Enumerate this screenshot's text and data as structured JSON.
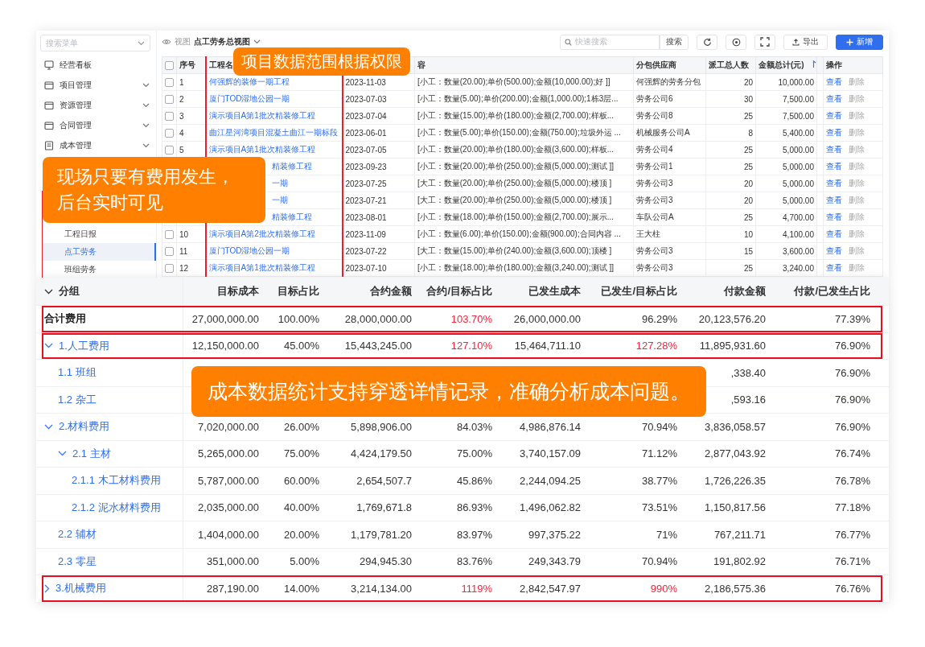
{
  "sidebar": {
    "search": {
      "placeholder": "搜索菜单"
    },
    "items": [
      {
        "label": "经营看板",
        "expandable": false
      },
      {
        "label": "项目管理",
        "expandable": true
      },
      {
        "label": "资源管理",
        "expandable": true
      },
      {
        "label": "合同管理",
        "expandable": true
      },
      {
        "label": "成本管理",
        "expandable": true
      }
    ],
    "submenu": {
      "highlighted": true,
      "items": [
        {
          "label": "工程日报",
          "selected": false
        },
        {
          "label": "点工劳务",
          "selected": true
        },
        {
          "label": "班组劳务",
          "selected": false
        }
      ]
    }
  },
  "toolbar": {
    "view_label": "视图",
    "view_name": "点工劳务总视图",
    "search": {
      "placeholder": "快速搜索"
    },
    "buttons": [
      {
        "kind": "search",
        "label": "搜索"
      },
      {
        "kind": "refresh"
      },
      {
        "kind": "settings"
      },
      {
        "kind": "fullscreen"
      },
      {
        "kind": "export",
        "label": "导出"
      },
      {
        "kind": "add",
        "label": "新增"
      }
    ]
  },
  "work_table": {
    "select_all_checked": false,
    "name_column_highlighted": true,
    "headers": {
      "seq": "序号",
      "name": "工程名",
      "content": "容",
      "supplier": "分包供应商",
      "workers": "派工总人数",
      "amount": "金额总计(元)",
      "actions": "操作"
    },
    "rows": [
      {
        "covered": false,
        "checked": false,
        "seq": "1",
        "name": "何强辉的装修一期工程",
        "date": "2023-11-03",
        "content": "[小工：数量(20.00);单价(500.00);金额(10,000.00);好 ]]",
        "supplier": "何强辉的劳务分包",
        "workers": "20",
        "amount": "10,000.00",
        "view": "查看",
        "delete": "删除"
      },
      {
        "covered": false,
        "checked": false,
        "seq": "2",
        "name": "厦门TOD湿地公园一期",
        "date": "2023-07-03",
        "content": "[小工：数量(5.00);单价(200.00);金额(1,000.00);1栋3层...",
        "supplier": "劳务公司6",
        "workers": "30",
        "amount": "7,500.00",
        "view": "查看",
        "delete": "删除"
      },
      {
        "covered": false,
        "checked": false,
        "seq": "3",
        "name": "演示项目A第1批次精装修工程",
        "date": "2023-07-04",
        "content": "[小工：数量(15.00);单价(180.00);金额(2,700.00);样板...",
        "supplier": "劳务公司8",
        "workers": "25",
        "amount": "7,500.00",
        "view": "查看",
        "delete": "删除"
      },
      {
        "covered": false,
        "checked": false,
        "seq": "4",
        "name": "曲江星河湾项目混凝土曲江一期标段",
        "date": "2023-06-01",
        "content": "[小工：数量(5.00);单价(150.00);金额(750.00);垃圾外运 ...",
        "supplier": "机械服务公司A",
        "workers": "8",
        "amount": "5,400.00",
        "view": "查看",
        "delete": "删除"
      },
      {
        "covered": false,
        "checked": false,
        "seq": "5",
        "name": "演示项目A第1批次精装修工程",
        "date": "2023-07-05",
        "content": "[小工：数量(20.00);单价(180.00);金额(3,600.00);样板...",
        "supplier": "劳务公司4",
        "workers": "25",
        "amount": "5,000.00",
        "view": "查看",
        "delete": "删除"
      },
      {
        "covered": true,
        "name": "精装修工程",
        "date": "2023-09-23",
        "content": "[小工：数量(20.00);单价(250.00);金额(5,000.00);测试 ]]",
        "supplier": "劳务公司1",
        "workers": "25",
        "amount": "5,000.00",
        "view": "查看",
        "delete": "删除"
      },
      {
        "covered": true,
        "name": "一期",
        "date": "2023-07-25",
        "content": "[大工：数量(20.00);单价(250.00);金额(5,000.00);楼顶 ]",
        "supplier": "劳务公司3",
        "workers": "20",
        "amount": "5,000.00",
        "view": "查看",
        "delete": "删除"
      },
      {
        "covered": true,
        "name": "一期",
        "date": "2023-07-21",
        "content": "[大工：数量(20.00);单价(250.00);金额(5,000.00);楼顶 ]",
        "supplier": "劳务公司3",
        "workers": "20",
        "amount": "5,000.00",
        "view": "查看",
        "delete": "删除"
      },
      {
        "covered": true,
        "name": "精装修工程",
        "date": "2023-08-01",
        "content": "[小工：数量(18.00);单价(150.00);金额(2,700.00);展示...",
        "supplier": "车队公司A",
        "workers": "25",
        "amount": "4,700.00",
        "view": "查看",
        "delete": "删除"
      },
      {
        "covered": false,
        "checked": false,
        "seq": "10",
        "name": "演示项目A第2批次精装修工程",
        "date": "2023-11-09",
        "content": "[小工：数量(6.00);单价(150.00);金额(900.00);合同内容 ...",
        "supplier": "王大柱",
        "workers": "10",
        "amount": "4,100.00",
        "view": "查看",
        "delete": "删除"
      },
      {
        "covered": false,
        "checked": false,
        "seq": "11",
        "name": "厦门TOD湿地公园一期",
        "date": "2023-07-22",
        "content": "[大工：数量(15.00);单价(240.00);金额(3,600.00);顶楼 ]",
        "supplier": "劳务公司3",
        "workers": "15",
        "amount": "3,600.00",
        "view": "查看",
        "delete": "删除"
      },
      {
        "covered": false,
        "checked": false,
        "seq": "12",
        "name": "演示项目A第1批次精装修工程",
        "date": "2023-07-10",
        "content": "[小工：数量(18.00);单价(180.00);金额(3,240.00);测试 ]]",
        "supplier": "劳务公司3",
        "workers": "25",
        "amount": "3,240.00",
        "view": "查看",
        "delete": "删除"
      }
    ]
  },
  "cost_table": {
    "group_column": "分组",
    "columns": [
      "目标成本",
      "目标占比",
      "合约金额",
      "合约/目标占比",
      "已发生成本",
      "已发生/目标占比",
      "付款金额",
      "付款/已发生占比"
    ],
    "rows": [
      {
        "kind": "total",
        "name": "合计费用",
        "highlighted": true,
        "contract_ratio_warning": true,
        "incurred_ratio_warning": false,
        "cells": [
          "27,000,000.00",
          "100.00%",
          "28,000,000.00",
          "103.70%",
          "26,000,000.00",
          "96.29%",
          "20,123,576.20",
          "77.39%"
        ]
      },
      {
        "kind": "group",
        "name": "1.人工费用",
        "expanded": true,
        "highlighted": true,
        "contract_ratio_warning": true,
        "incurred_ratio_warning": true,
        "cells": [
          "12,150,000.00",
          "45.00%",
          "15,443,245.00",
          "127.10%",
          "15,464,711.10",
          "127.28%",
          "11,895,931.60",
          "76.90%"
        ],
        "children": [
          {
            "kind": "item",
            "name": "1.1 班组",
            "highlighted": false,
            "cells": [
              null,
              null,
              null,
              null,
              null,
              null,
              ",338.40",
              "76.90%"
            ]
          },
          {
            "kind": "item",
            "name": "1.2 杂工",
            "highlighted": false,
            "cells": [
              null,
              null,
              null,
              null,
              null,
              null,
              ",593.16",
              "76.90%"
            ]
          }
        ]
      },
      {
        "kind": "group",
        "name": "2.材料费用",
        "expanded": true,
        "highlighted": false,
        "contract_ratio_warning": false,
        "incurred_ratio_warning": false,
        "cells": [
          "7,020,000.00",
          "26.00%",
          "5,898,906.00",
          "84.03%",
          "4,986,876.14",
          "70.94%",
          "3,836,058.57",
          "76.90%"
        ],
        "children": [
          {
            "kind": "group",
            "name": "2.1 主材",
            "expanded": true,
            "highlighted": false,
            "contract_ratio_warning": false,
            "incurred_ratio_warning": false,
            "cells": [
              "5,265,000.00",
              "75.00%",
              "4,424,179.50",
              "75.00%",
              "3,740,157.09",
              "71.12%",
              "2,877,043.92",
              "76.74%"
            ],
            "children": [
              {
                "kind": "item",
                "name": "2.1.1 木工材料费用",
                "highlighted": false,
                "contract_ratio_warning": false,
                "incurred_ratio_warning": false,
                "cells": [
                  "5,787,000.00",
                  "60.00%",
                  "2,654,507.7",
                  "45.86%",
                  "2,244,094.25",
                  "38.77%",
                  "1,726,226.35",
                  "76.78%"
                ]
              },
              {
                "kind": "item",
                "name": "2.1.2 泥水材料费用",
                "highlighted": false,
                "contract_ratio_warning": false,
                "incurred_ratio_warning": false,
                "cells": [
                  "2,035,000.00",
                  "40.00%",
                  "1,769,671.8",
                  "86.93%",
                  "1,496,062.82",
                  "73.51%",
                  "1,150,817.56",
                  "77.18%"
                ]
              }
            ]
          },
          {
            "kind": "item",
            "name": "2.2 辅材",
            "highlighted": false,
            "contract_ratio_warning": false,
            "incurred_ratio_warning": false,
            "cells": [
              "1,404,000.00",
              "20.00%",
              "1,179,781.20",
              "83.97%",
              "997,375.22",
              "71%",
              "767,211.71",
              "76.77%"
            ]
          },
          {
            "kind": "item",
            "name": "2.3 零星",
            "highlighted": false,
            "contract_ratio_warning": false,
            "incurred_ratio_warning": false,
            "cells": [
              "351,000.00",
              "5.00%",
              "294,945.30",
              "83.76%",
              "249,343.79",
              "70.94%",
              "191,802.92",
              "76.71%"
            ]
          }
        ]
      },
      {
        "kind": "group",
        "name": "3.机械费用",
        "expanded": false,
        "highlighted": true,
        "contract_ratio_warning": true,
        "incurred_ratio_warning": true,
        "cells": [
          "287,190.00",
          "14.00%",
          "3,214,134.00",
          "1119%",
          "2,842,547.97",
          "990%",
          "2,186,575.36",
          "76.76%"
        ]
      }
    ]
  },
  "callouts": [
    {
      "kind": "top",
      "lines": [
        "项目数据范围根据权限"
      ]
    },
    {
      "kind": "left",
      "lines": [
        "现场只要有费用发生，",
        "后台实时可见"
      ]
    },
    {
      "kind": "bottom",
      "lines": [
        "成本数据统计支持穿透详情记录，准确分析成本问题。"
      ]
    }
  ]
}
